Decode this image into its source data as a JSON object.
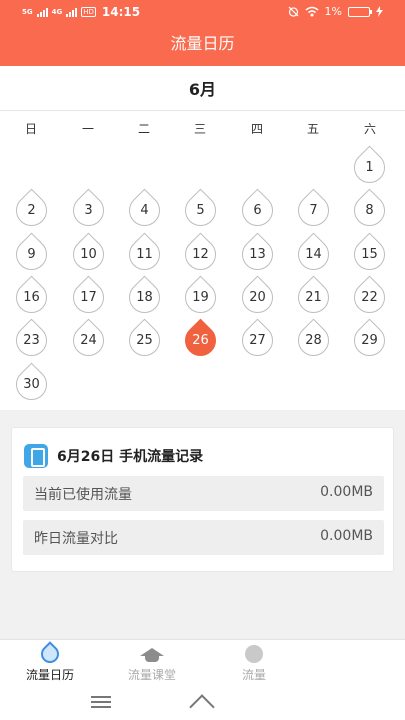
{
  "status_bar": {
    "signal1": "5G",
    "signal2": "4G",
    "hd": "HD",
    "time": "14:15",
    "battery": "1%"
  },
  "header": {
    "title": "流量日历"
  },
  "calendar": {
    "month": "6月",
    "weekdays": [
      "日",
      "一",
      "二",
      "三",
      "四",
      "五",
      "六"
    ],
    "days": [
      "1",
      "2",
      "3",
      "4",
      "5",
      "6",
      "7",
      "8",
      "9",
      "10",
      "11",
      "12",
      "13",
      "14",
      "15",
      "16",
      "17",
      "18",
      "19",
      "20",
      "21",
      "22",
      "23",
      "24",
      "25",
      "26",
      "27",
      "28",
      "29",
      "30"
    ],
    "first_weekday": 6,
    "selected_day": "26",
    "selected_color": "#f0623f"
  },
  "record": {
    "title": "6月26日 手机流量记录",
    "rows": [
      {
        "label": "当前已使用流量",
        "value": "0.00MB"
      },
      {
        "label": "昨日流量对比",
        "value": "0.00MB"
      }
    ]
  },
  "tabs": [
    {
      "label": "流量日历",
      "icon": "water-drop-icon",
      "active": true
    },
    {
      "label": "流量课堂",
      "icon": "graduation-cap-icon",
      "active": false
    },
    {
      "label": "流量",
      "icon": "lightning-icon",
      "active": false
    }
  ],
  "colors": {
    "accent": "#fa6a4e",
    "tab_active_icon": "#3b8ee6"
  }
}
